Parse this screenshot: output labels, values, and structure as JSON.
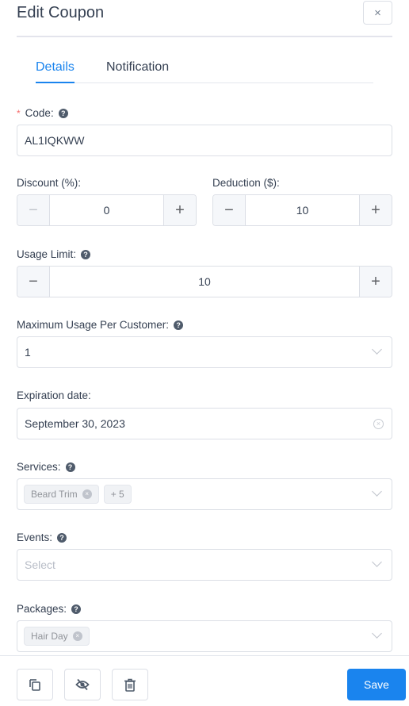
{
  "header": {
    "title": "Edit Coupon",
    "close_label": "×"
  },
  "tabs": [
    {
      "label": "Details",
      "active": true
    },
    {
      "label": "Notification",
      "active": false
    }
  ],
  "form": {
    "code": {
      "label": "Code:",
      "required_mark": "*",
      "value": "AL1IQKWW"
    },
    "discount": {
      "label": "Discount (%):",
      "value": "0",
      "minus": "−",
      "plus": "+"
    },
    "deduction": {
      "label": "Deduction ($):",
      "value": "10",
      "minus": "−",
      "plus": "+"
    },
    "usage_limit": {
      "label": "Usage Limit:",
      "value": "10",
      "minus": "−",
      "plus": "+"
    },
    "max_usage": {
      "label": "Maximum Usage Per Customer:",
      "value": "1"
    },
    "expiration": {
      "label": "Expiration date:",
      "value": "September 30, 2023"
    },
    "services": {
      "label": "Services:",
      "tags": [
        "Beard Trim"
      ],
      "more": "+ 5"
    },
    "events": {
      "label": "Events:",
      "placeholder": "Select"
    },
    "packages": {
      "label": "Packages:",
      "tags": [
        "Hair Day"
      ]
    }
  },
  "help_glyph": "?",
  "tag_close_glyph": "×",
  "footer": {
    "duplicate_icon": "duplicate-icon",
    "hide_icon": "eye-slash-icon",
    "delete_icon": "trash-icon",
    "save_label": "Save"
  },
  "colors": {
    "primary": "#1a84ee",
    "text": "#354052",
    "required": "#f56c6c"
  }
}
